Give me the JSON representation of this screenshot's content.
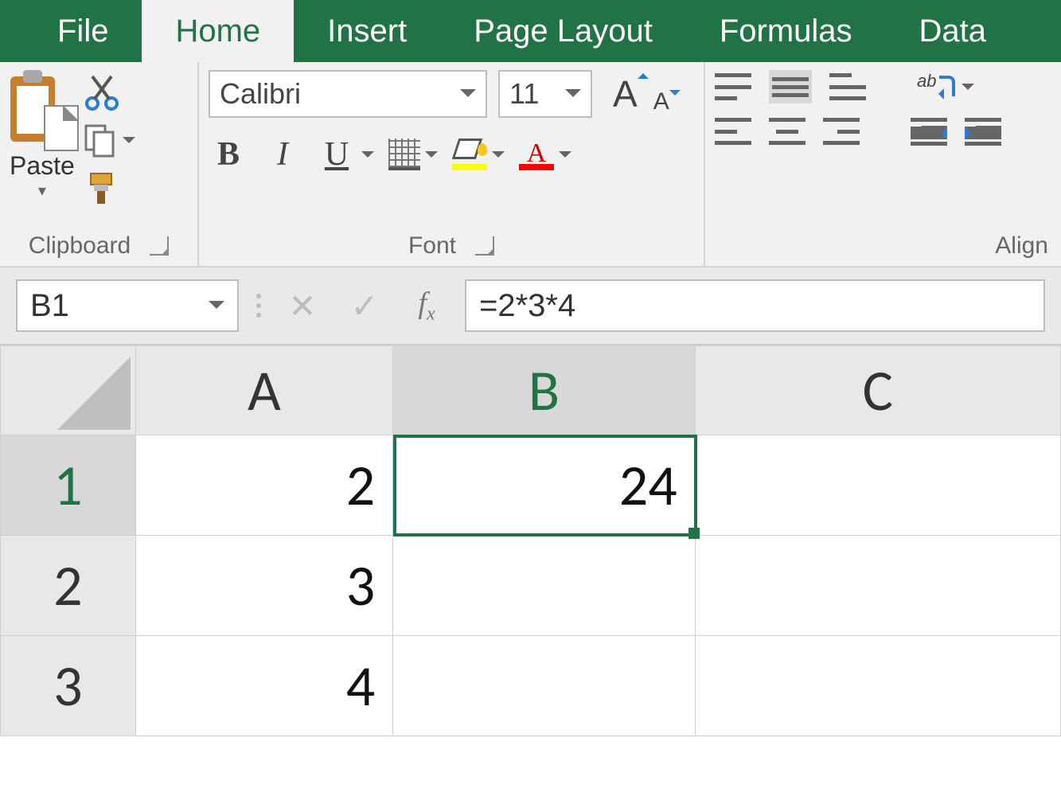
{
  "tabs": {
    "file": "File",
    "home": "Home",
    "insert": "Insert",
    "page_layout": "Page Layout",
    "formulas": "Formulas",
    "data": "Data"
  },
  "ribbon": {
    "clipboard": {
      "label": "Clipboard",
      "paste": "Paste"
    },
    "font": {
      "label": "Font",
      "name": "Calibri",
      "size": "11",
      "bold": "B",
      "italic": "I",
      "underline": "U"
    },
    "alignment": {
      "label": "Alignment",
      "label_visible": "Align",
      "wrap_ab": "ab"
    }
  },
  "formula_bar": {
    "name_box": "B1",
    "formula": "=2*3*4"
  },
  "grid": {
    "columns": [
      "A",
      "B",
      "C"
    ],
    "rows": [
      "1",
      "2",
      "3"
    ],
    "selected_col": "B",
    "selected_row": "1",
    "cells": {
      "A1": "2",
      "A2": "3",
      "A3": "4",
      "B1": "24"
    }
  }
}
